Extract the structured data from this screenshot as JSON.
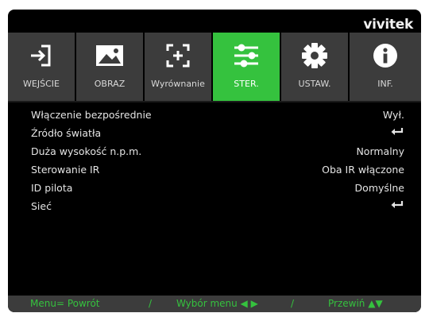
{
  "brand": "vivitek",
  "tabs": [
    {
      "label": "WEJŚCIE",
      "icon": "input-icon",
      "active": false
    },
    {
      "label": "OBRAZ",
      "icon": "image-icon",
      "active": false
    },
    {
      "label": "Wyrównanie",
      "icon": "alignment-icon",
      "active": false
    },
    {
      "label": "STER.",
      "icon": "sliders-icon",
      "active": true
    },
    {
      "label": "USTAW.",
      "icon": "gear-icon",
      "active": false
    },
    {
      "label": "INF.",
      "icon": "info-icon",
      "active": false
    }
  ],
  "menu": [
    {
      "label": "Włączenie bezpośrednie",
      "value": "Wył."
    },
    {
      "label": "Źródło światła",
      "value": "",
      "enter": true
    },
    {
      "label": "Duża wysokość n.p.m.",
      "value": "Normalny"
    },
    {
      "label": "Sterowanie IR",
      "value": "Oba IR włączone"
    },
    {
      "label": "ID pilota",
      "value": "Domyślne"
    },
    {
      "label": "Sieć",
      "value": "",
      "enter": true
    }
  ],
  "footer": {
    "menu_back": "Menu= Powrót",
    "sep1": "/",
    "select_menu": "Wybór menu ◀ ▶",
    "sep2": "/",
    "scroll": "Przewiń ▲▼"
  },
  "colors": {
    "accent": "#35c23e",
    "bar": "#3c3c3c",
    "background": "#000000"
  }
}
